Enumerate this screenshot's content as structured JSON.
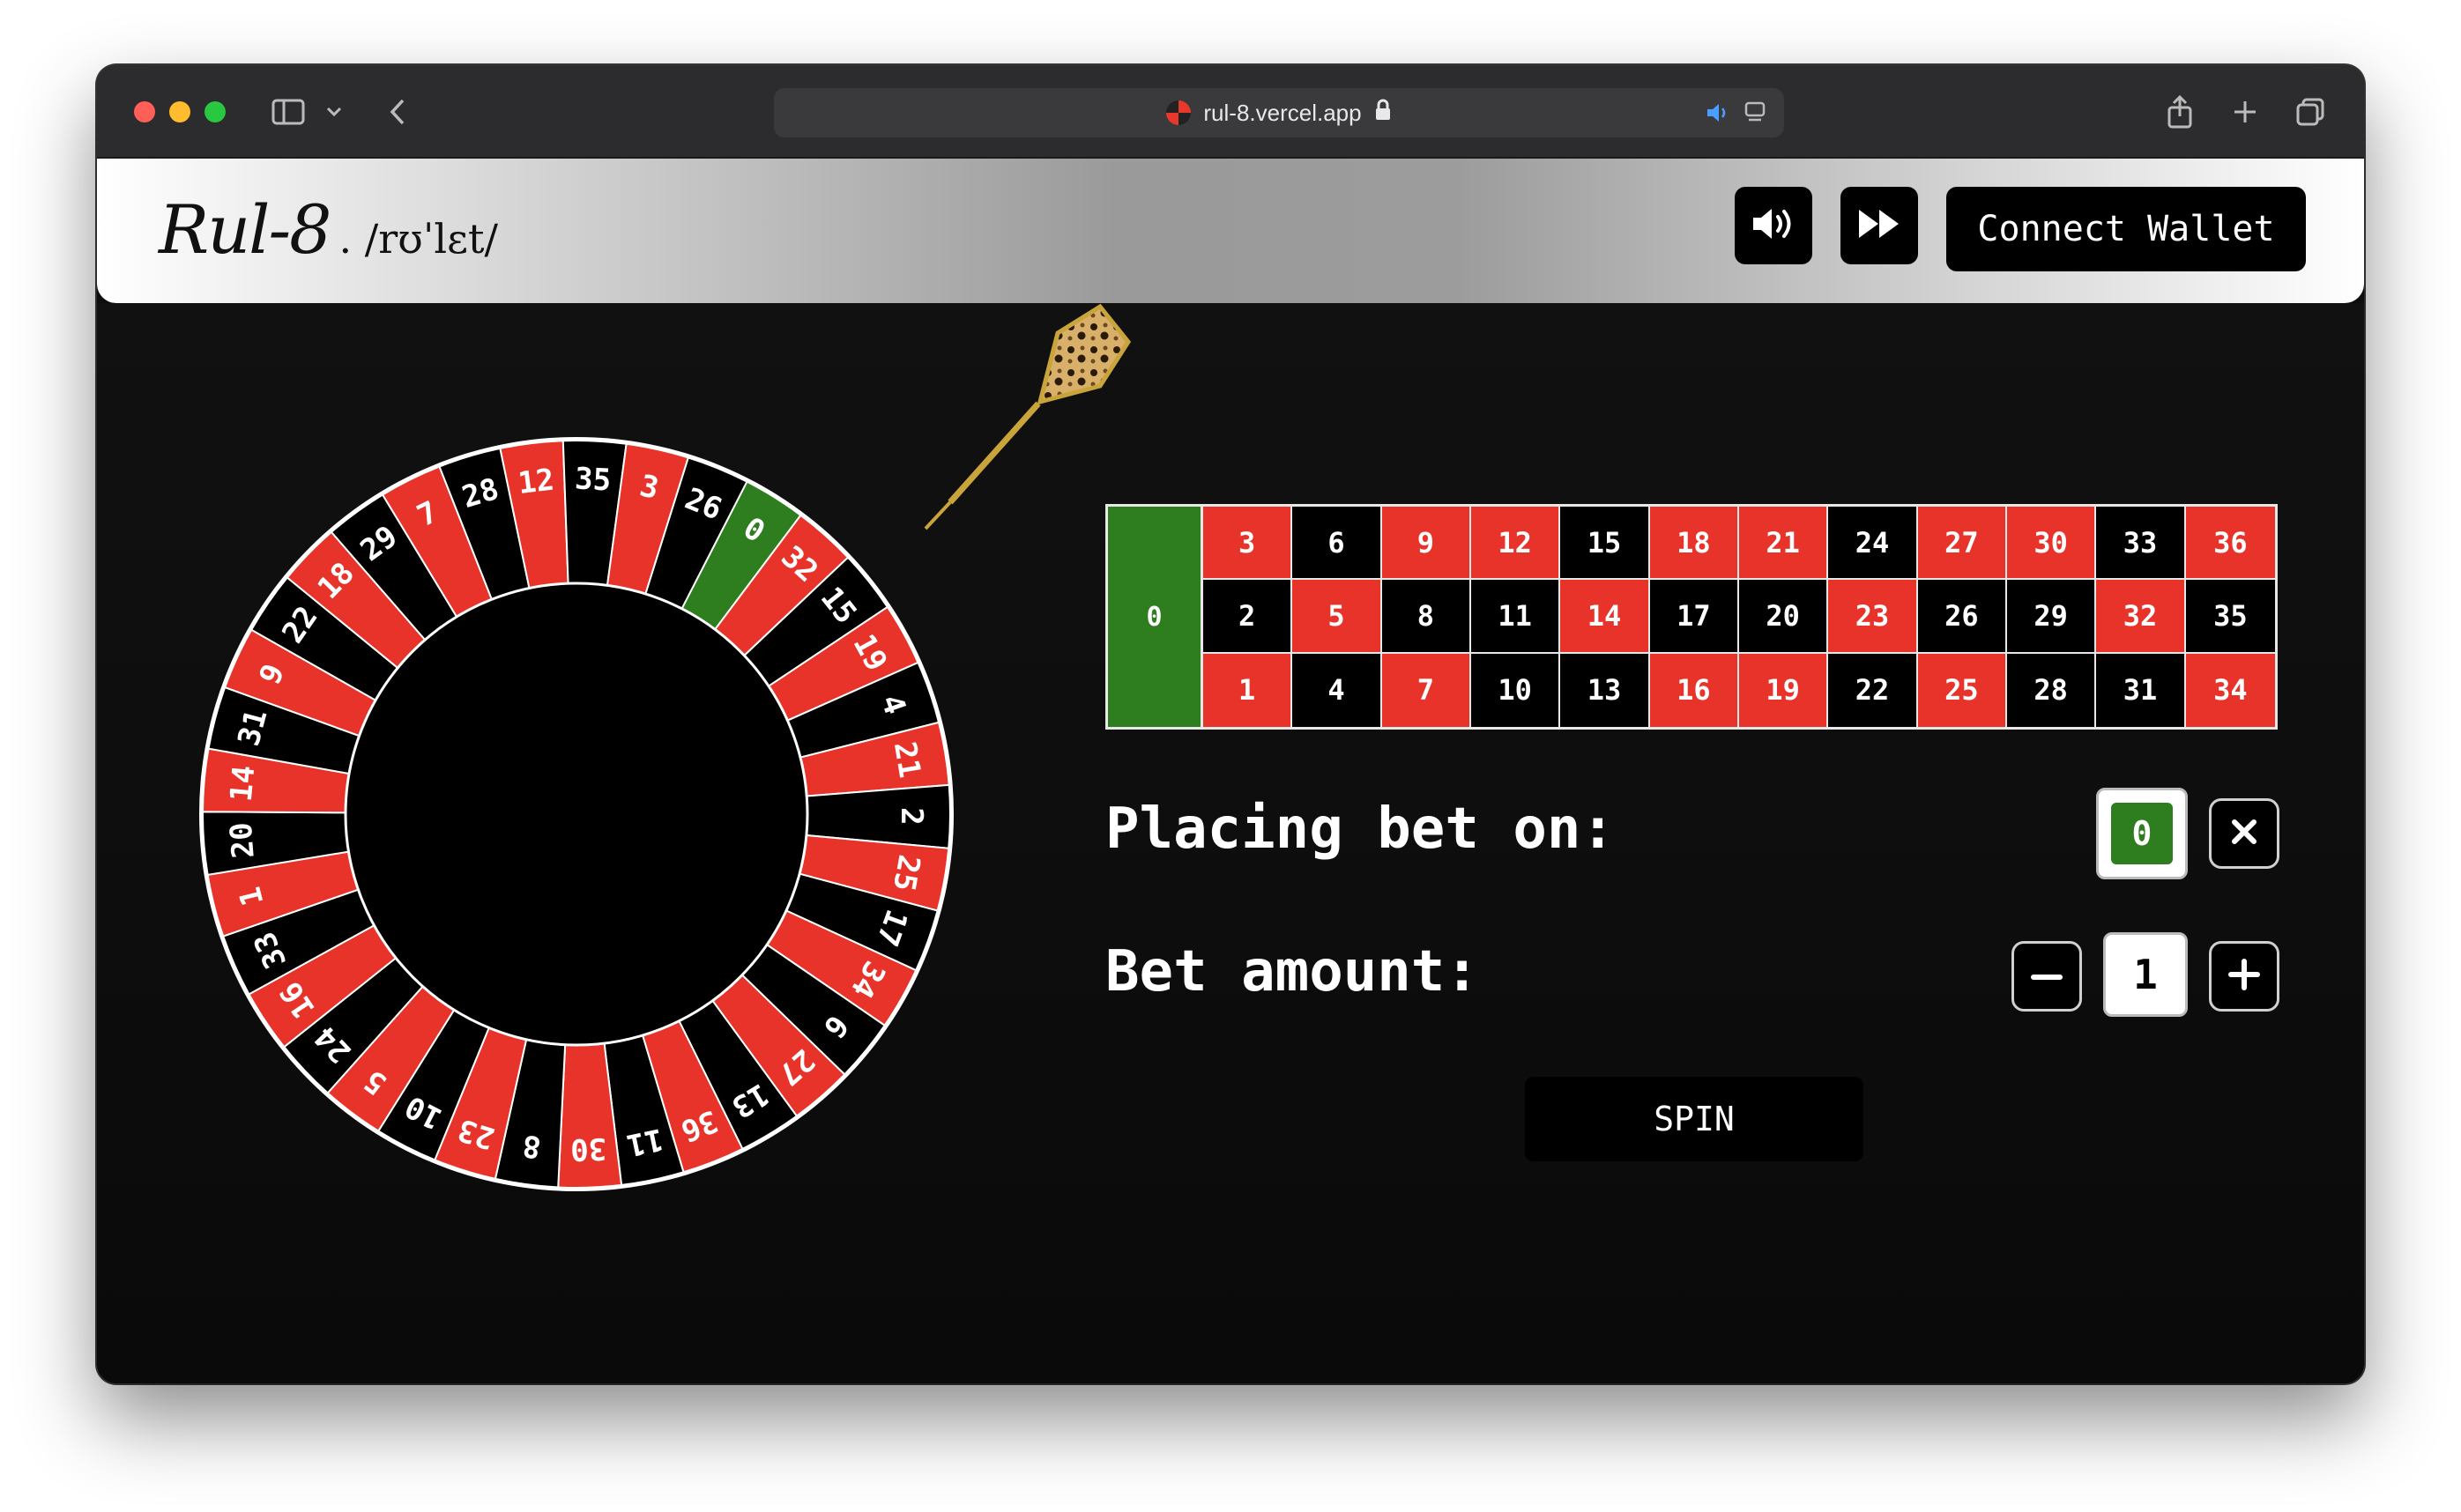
{
  "browser": {
    "url": "rul-8.vercel.app"
  },
  "header": {
    "logo_text": "Rul-8",
    "logo_pronunciation": ". /rʊˈlɛt/",
    "connect_label": "Connect Wallet"
  },
  "board": {
    "zero": "0",
    "rows": [
      [
        {
          "n": "3",
          "c": "red"
        },
        {
          "n": "6",
          "c": "black"
        },
        {
          "n": "9",
          "c": "red"
        },
        {
          "n": "12",
          "c": "red"
        },
        {
          "n": "15",
          "c": "black"
        },
        {
          "n": "18",
          "c": "red"
        },
        {
          "n": "21",
          "c": "red"
        },
        {
          "n": "24",
          "c": "black"
        },
        {
          "n": "27",
          "c": "red"
        },
        {
          "n": "30",
          "c": "red"
        },
        {
          "n": "33",
          "c": "black"
        },
        {
          "n": "36",
          "c": "red"
        }
      ],
      [
        {
          "n": "2",
          "c": "black"
        },
        {
          "n": "5",
          "c": "red"
        },
        {
          "n": "8",
          "c": "black"
        },
        {
          "n": "11",
          "c": "black"
        },
        {
          "n": "14",
          "c": "red"
        },
        {
          "n": "17",
          "c": "black"
        },
        {
          "n": "20",
          "c": "black"
        },
        {
          "n": "23",
          "c": "red"
        },
        {
          "n": "26",
          "c": "black"
        },
        {
          "n": "29",
          "c": "black"
        },
        {
          "n": "32",
          "c": "red"
        },
        {
          "n": "35",
          "c": "black"
        }
      ],
      [
        {
          "n": "1",
          "c": "red"
        },
        {
          "n": "4",
          "c": "black"
        },
        {
          "n": "7",
          "c": "red"
        },
        {
          "n": "10",
          "c": "black"
        },
        {
          "n": "13",
          "c": "black"
        },
        {
          "n": "16",
          "c": "red"
        },
        {
          "n": "19",
          "c": "red"
        },
        {
          "n": "22",
          "c": "black"
        },
        {
          "n": "25",
          "c": "red"
        },
        {
          "n": "28",
          "c": "black"
        },
        {
          "n": "31",
          "c": "black"
        },
        {
          "n": "34",
          "c": "red"
        }
      ]
    ]
  },
  "wheel": {
    "pockets": [
      "0",
      "32",
      "15",
      "19",
      "4",
      "21",
      "2",
      "25",
      "17",
      "34",
      "6",
      "27",
      "13",
      "36",
      "11",
      "30",
      "8",
      "23",
      "10",
      "5",
      "24",
      "16",
      "33",
      "1",
      "20",
      "14",
      "31",
      "9",
      "22",
      "18",
      "29",
      "7",
      "28",
      "12",
      "35",
      "3",
      "26"
    ],
    "colors": {
      "red": "#e8332a",
      "black": "#000000",
      "green": "#2e7d1f"
    }
  },
  "bet": {
    "placing_label": "Placing bet on:",
    "selected": "0",
    "amount_label": "Bet amount:",
    "amount": "1",
    "spin_label": "SPIN"
  }
}
